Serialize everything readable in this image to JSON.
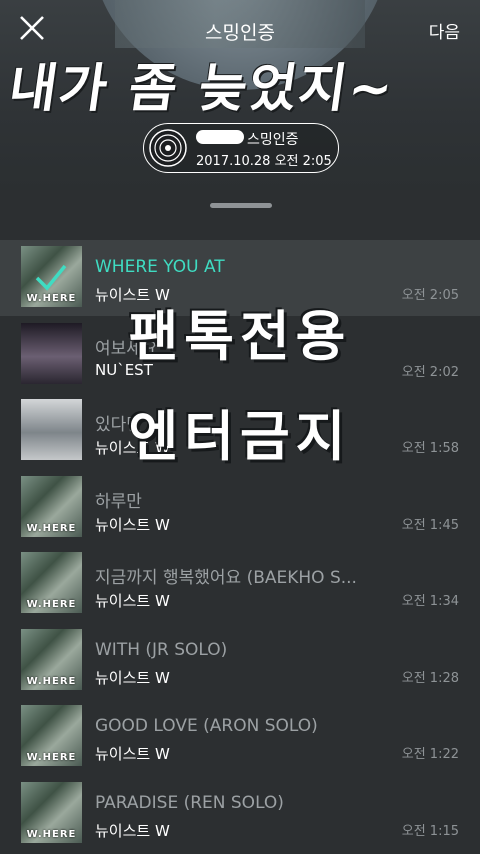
{
  "header": {
    "title": "스밍인증",
    "next_label": "다음",
    "overlay_text": "내가 좀 늦었지~",
    "badge": {
      "label": "스밍인증",
      "date": "2017.10.28 오전 2:05"
    }
  },
  "list": {
    "caption": "",
    "songs": [
      {
        "title": "WHERE YOU AT",
        "artist": "뉴이스트 W",
        "time": "오전 2:05",
        "selected": true,
        "cover_word": "W.HERE"
      },
      {
        "title": "여보세요",
        "artist": "NU`EST",
        "time": "오전 2:02",
        "selected": false,
        "cover_word": ""
      },
      {
        "title": "있다면",
        "artist": "뉴이스트 W",
        "time": "오전 1:58",
        "selected": false,
        "cover_word": ""
      },
      {
        "title": "하루만",
        "artist": "뉴이스트 W",
        "time": "오전 1:45",
        "selected": false,
        "cover_word": "W.HERE"
      },
      {
        "title": "지금까지 행복했어요 (BAEKHO S...",
        "artist": "뉴이스트 W",
        "time": "오전 1:34",
        "selected": false,
        "cover_word": "W.HERE"
      },
      {
        "title": "WITH (JR SOLO)",
        "artist": "뉴이스트 W",
        "time": "오전 1:28",
        "selected": false,
        "cover_word": "W.HERE"
      },
      {
        "title": "GOOD LOVE (ARON SOLO)",
        "artist": "뉴이스트 W",
        "time": "오전 1:22",
        "selected": false,
        "cover_word": "W.HERE"
      },
      {
        "title": "PARADISE (REN SOLO)",
        "artist": "뉴이스트 W",
        "time": "오전 1:15",
        "selected": false,
        "cover_word": "W.HERE"
      }
    ]
  },
  "overlay": {
    "line1": "팬톡전용",
    "line2": "엔터금지"
  },
  "colors": {
    "accent": "#3fdcc2",
    "background": "#2c2f31"
  }
}
